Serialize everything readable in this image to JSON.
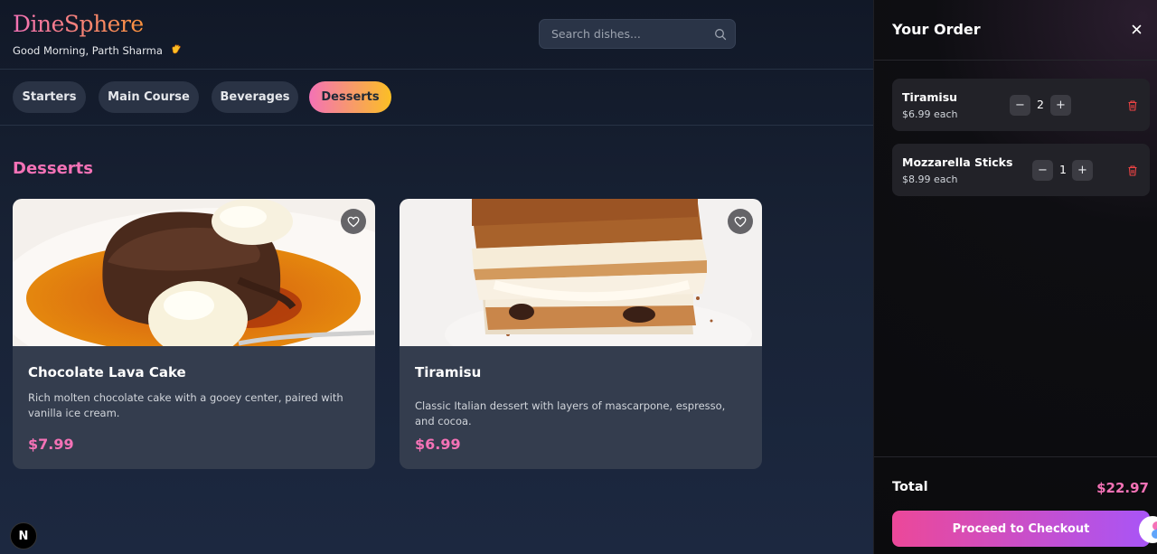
{
  "brand": {
    "name": "DineSphere",
    "greeting": "Good Morning, Parth Sharma"
  },
  "search": {
    "placeholder": "Search dishes...",
    "icon": "search-icon"
  },
  "tabs": [
    {
      "label": "Starters",
      "active": false
    },
    {
      "label": "Main Course",
      "active": false
    },
    {
      "label": "Beverages",
      "active": false
    },
    {
      "label": "Desserts",
      "active": true
    }
  ],
  "section": {
    "title": "Desserts"
  },
  "dishes": [
    {
      "name": "Chocolate Lava Cake",
      "description": "Rich molten chocolate cake with a gooey center, paired with vanilla ice cream.",
      "price": "$7.99",
      "favorite_icon": "heart-icon"
    },
    {
      "name": "Tiramisu",
      "description": "Classic Italian dessert with layers of mascarpone, espresso, and cocoa.",
      "price": "$6.99",
      "favorite_icon": "heart-icon"
    }
  ],
  "order": {
    "title": "Your Order",
    "items": [
      {
        "name": "Tiramisu",
        "price_each": "$6.99 each",
        "quantity": "2"
      },
      {
        "name": "Mozzarella Sticks",
        "price_each": "$8.99 each",
        "quantity": "1"
      }
    ],
    "total_label": "Total",
    "total_value": "$22.97",
    "checkout_label": "Proceed to Checkout"
  },
  "dev_badge": "N",
  "colors": {
    "accent_pink": "#f472b6",
    "accent_orange": "#fbbf24",
    "accent_purple": "#a855f7",
    "delete_red": "#ef4444"
  }
}
